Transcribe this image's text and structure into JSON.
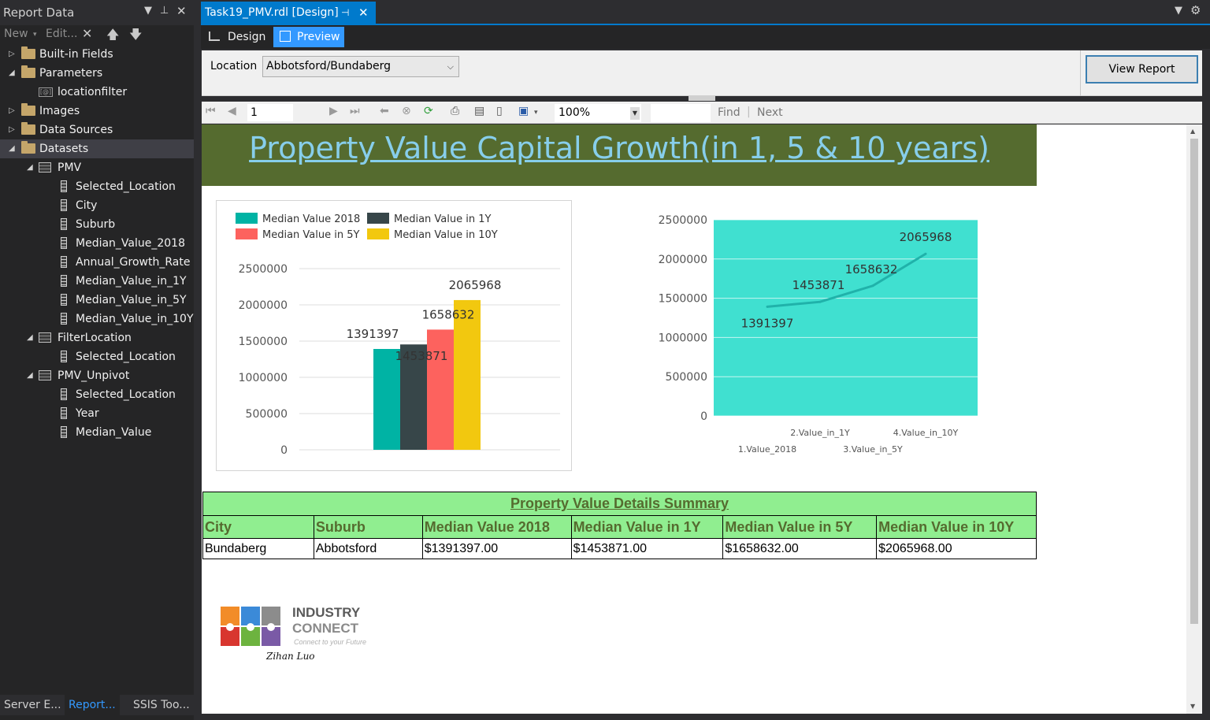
{
  "left_panel": {
    "title": "Report Data",
    "toolbar": {
      "new_label": "New",
      "edit_label": "Edit..."
    },
    "tree": [
      {
        "label": "Built-in Fields",
        "type": "folder",
        "level": 0,
        "expanded": false
      },
      {
        "label": "Parameters",
        "type": "folder",
        "level": 0,
        "expanded": true
      },
      {
        "label": "locationfilter",
        "type": "parameter",
        "level": 1
      },
      {
        "label": "Images",
        "type": "folder",
        "level": 0,
        "expanded": false
      },
      {
        "label": "Data Sources",
        "type": "folder",
        "level": 0,
        "expanded": false
      },
      {
        "label": "Datasets",
        "type": "folder",
        "level": 0,
        "expanded": true,
        "selected": true
      },
      {
        "label": "PMV",
        "type": "dataset",
        "level": 1,
        "expanded": true
      },
      {
        "label": "Selected_Location",
        "type": "field",
        "level": 2
      },
      {
        "label": "City",
        "type": "field",
        "level": 2
      },
      {
        "label": "Suburb",
        "type": "field",
        "level": 2
      },
      {
        "label": "Median_Value_2018",
        "type": "field",
        "level": 2
      },
      {
        "label": "Annual_Growth_Rate",
        "type": "field",
        "level": 2
      },
      {
        "label": "Median_Value_in_1Y",
        "type": "field",
        "level": 2
      },
      {
        "label": "Median_Value_in_5Y",
        "type": "field",
        "level": 2
      },
      {
        "label": "Median_Value_in_10Y",
        "type": "field",
        "level": 2
      },
      {
        "label": "FilterLocation",
        "type": "dataset",
        "level": 1,
        "expanded": true
      },
      {
        "label": "Selected_Location",
        "type": "field",
        "level": 2
      },
      {
        "label": "PMV_Unpivot",
        "type": "dataset",
        "level": 1,
        "expanded": true
      },
      {
        "label": "Selected_Location",
        "type": "field",
        "level": 2
      },
      {
        "label": "Year",
        "type": "field",
        "level": 2
      },
      {
        "label": "Median_Value",
        "type": "field",
        "level": 2
      }
    ],
    "bottom_tabs": [
      "Server E...",
      "Report...",
      "SSIS Too..."
    ],
    "active_bottom_tab": 1
  },
  "document": {
    "tab_title": "Task19_PMV.rdl [Design]",
    "design_label": "Design",
    "preview_label": "Preview"
  },
  "parameters": {
    "location_label": "Location",
    "location_value": "Abbotsford/Bundaberg",
    "view_report_label": "View Report"
  },
  "toolbar": {
    "page_number": "1",
    "zoom": "100%",
    "find_label": "Find",
    "next_label": "Next"
  },
  "report": {
    "title": "Property Value Capital Growth(in 1, 5 & 10 years)",
    "colors": {
      "banner": "#556b2f",
      "title": "#87ceeb",
      "table_header_bg": "#90ee90",
      "table_header_text": "#556b2f",
      "line_plot_bg": "#40e0d0"
    },
    "table": {
      "caption": "Property Value Details Summary",
      "columns": [
        "City",
        "Suburb",
        "Median Value 2018",
        "Median Value in 1Y",
        "Median Value in 5Y",
        "Median Value in 10Y"
      ],
      "rows": [
        [
          "Bundaberg",
          "Abbotsford",
          "$1391397.00",
          "$1453871.00",
          "$1658632.00",
          "$2065968.00"
        ]
      ]
    },
    "logo": {
      "word1": "INDUSTRY",
      "word2": "CONNECT",
      "tagline": "Connect to your Future",
      "signature": "Zihan Luo"
    }
  },
  "chart_data": [
    {
      "type": "bar",
      "title": "",
      "categories": [
        ""
      ],
      "series": [
        {
          "name": "Median Value 2018",
          "values": [
            1391397
          ],
          "color": "#00b3a4"
        },
        {
          "name": "Median Value in 1Y",
          "values": [
            1453871
          ],
          "color": "#374649"
        },
        {
          "name": "Median Value in 5Y",
          "values": [
            1658632
          ],
          "color": "#fd625e"
        },
        {
          "name": "Median Value in 10Y",
          "values": [
            2065968
          ],
          "color": "#f2c80f"
        }
      ],
      "yticks": [
        "0",
        "500000",
        "1000000",
        "1500000",
        "2000000",
        "2500000"
      ],
      "ylim": [
        0,
        2500000
      ],
      "grid": true,
      "legend": "top-left",
      "data_labels": true
    },
    {
      "type": "line",
      "title": "",
      "x": [
        "1.Value_2018",
        "2.Value_in_1Y",
        "3.Value_in_5Y",
        "4.Value_in_10Y"
      ],
      "series": [
        {
          "values": [
            1391397,
            1453871,
            1658632,
            2065968
          ],
          "color": "#20b2aa"
        }
      ],
      "yticks": [
        "0",
        "500000",
        "1000000",
        "1500000",
        "2000000",
        "2500000"
      ],
      "ylim": [
        0,
        2500000
      ],
      "grid": true,
      "data_labels": true
    }
  ]
}
